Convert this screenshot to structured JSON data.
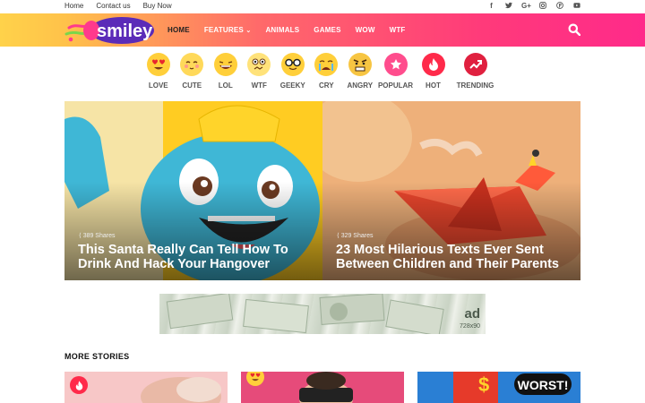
{
  "topbar": {
    "links": [
      "Home",
      "Contact us",
      "Buy Now"
    ],
    "social": [
      "f",
      "t",
      "G+",
      "in",
      "p",
      "yt"
    ]
  },
  "logo": {
    "text": "smiley"
  },
  "nav": {
    "items": [
      "HOME",
      "FEATURES",
      "ANIMALS",
      "GAMES",
      "WOW",
      "WTF"
    ],
    "active": "HOME",
    "features_caret": "⌄"
  },
  "reactions": [
    {
      "label": "LOVE",
      "icon": "heart-eyes-icon"
    },
    {
      "label": "CUTE",
      "icon": "blush-face-icon"
    },
    {
      "label": "LOL",
      "icon": "laughing-face-icon"
    },
    {
      "label": "WTF",
      "icon": "confused-face-icon"
    },
    {
      "label": "GEEKY",
      "icon": "nerd-face-icon"
    },
    {
      "label": "CRY",
      "icon": "crying-face-icon"
    },
    {
      "label": "ANGRY",
      "icon": "angry-face-icon"
    },
    {
      "label": "POPULAR",
      "icon": "star-icon"
    },
    {
      "label": "HOT",
      "icon": "flame-icon"
    },
    {
      "label": "TRENDING",
      "icon": "trending-icon"
    }
  ],
  "featured": [
    {
      "shares": "389 Shares",
      "title": "This Santa Really Can Tell How To Drink And Hack Your Hangover"
    },
    {
      "shares": "329 Shares",
      "title": "23 Most Hilarious Texts Ever Sent Between Children and Their Parents"
    }
  ],
  "ad": {
    "label": "ad",
    "size": "728x90"
  },
  "more_stories": {
    "heading": "MORE STORIES",
    "card3_label": "WORST!"
  },
  "colors": {
    "accent": "#ff2a6d",
    "nav_gradient_start": "#ffd24a",
    "nav_gradient_end": "#ff2a8a"
  }
}
